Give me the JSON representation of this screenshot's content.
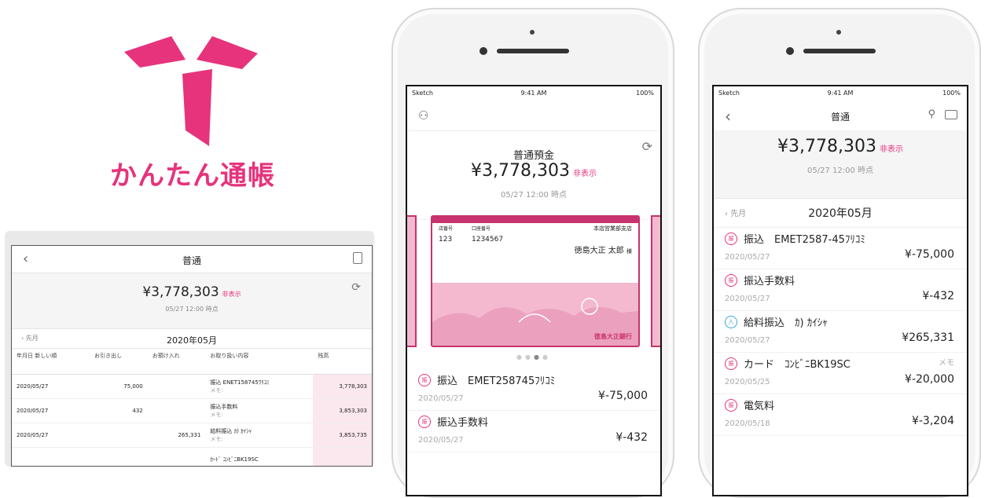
{
  "brand": {
    "title": "かんたん通帳",
    "color": "#e6337c"
  },
  "tablet": {
    "nav_title": "普通",
    "back_icon": "‹",
    "amount": "¥3,778,303",
    "hide_label": "非表示",
    "as_of": "05/27 12:00 時点",
    "prev_label": "先月",
    "month": "2020年05月",
    "columns": [
      "年月日 新しい順",
      "お引き出し",
      "お預け入れ",
      "お取り扱い内容",
      "残高"
    ],
    "rows": [
      {
        "date": "2020/05/27",
        "out": "75,000",
        "in": "",
        "desc": "振込 ENET158745ﾜﾘｺﾐ",
        "memo": "メモ:",
        "balance": "3,778,303"
      },
      {
        "date": "2020/05/27",
        "out": "432",
        "in": "",
        "desc": "振込手数料",
        "memo": "メモ:",
        "balance": "3,853,303"
      },
      {
        "date": "2020/05/27",
        "out": "",
        "in": "265,331",
        "desc": "給料振込 ｶ) ｶｲｼｬ",
        "memo": "メモ:",
        "balance": "3,853,735"
      },
      {
        "date": "",
        "out": "",
        "in": "",
        "desc": "ｶｰﾄﾞ ｺﾝﾋﾞﾆBK19SC",
        "memo": "",
        "balance": ""
      }
    ]
  },
  "phone1": {
    "status": {
      "carrier": "Sketch",
      "time": "9:41 AM",
      "battery": "100%"
    },
    "account_title": "普通預金",
    "amount": "¥3,778,303",
    "hide_label": "非表示",
    "as_of": "05/27 12:00 時点",
    "card": {
      "store_no_label": "店番号",
      "account_no_label": "口座番号",
      "store_no": "123",
      "account_no": "1234567",
      "branch": "本店営業部支店",
      "holder": "徳島大正 太郎",
      "honorific": "様",
      "bank": "徳島大正銀行"
    },
    "transactions": [
      {
        "icon": "振",
        "name": "振込　EMET258745ﾌﾘｺﾐ",
        "date": "2020/05/27",
        "amount": "¥-75,000"
      },
      {
        "icon": "振",
        "name": "振込手数料",
        "date": "2020/05/27",
        "amount": "¥-432"
      }
    ]
  },
  "phone2": {
    "status": {
      "carrier": "Sketch",
      "time": "9:41 AM",
      "battery": "100%"
    },
    "nav_title": "普通",
    "amount": "¥3,778,303",
    "hide_label": "非表示",
    "as_of": "05/27 12:00 時点",
    "prev_label": "先月",
    "month": "2020年05月",
    "transactions": [
      {
        "icon": "振",
        "name": "振込　EMET2587-45ﾌﾘｺﾐ",
        "date": "2020/05/27",
        "amount": "¥-75,000",
        "memo": "",
        "blue": false
      },
      {
        "icon": "振",
        "name": "振込手数料",
        "date": "2020/05/27",
        "amount": "¥-432",
        "memo": "",
        "blue": false
      },
      {
        "icon": "入",
        "name": "給料振込　ｶ) ｶｲｼｬ",
        "date": "2020/05/27",
        "amount": "¥265,331",
        "memo": "",
        "blue": true
      },
      {
        "icon": "振",
        "name": "カード　ｺﾝﾋﾞﾆBK19SC",
        "date": "2020/05/25",
        "amount": "¥-20,000",
        "memo": "メモ",
        "blue": false
      },
      {
        "icon": "振",
        "name": "電気料",
        "date": "2020/05/18",
        "amount": "¥-3,204",
        "memo": "",
        "blue": false
      }
    ]
  }
}
